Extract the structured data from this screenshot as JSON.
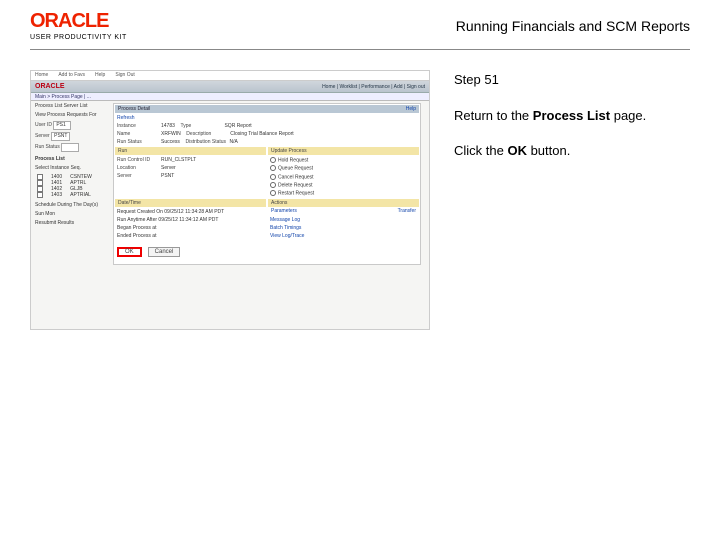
{
  "header": {
    "logo": "ORACLE",
    "productLine": "USER PRODUCTIVITY KIT",
    "title": "Running Financials and SCM Reports"
  },
  "instructions": {
    "step": "Step 51",
    "line1a": "Return to the ",
    "line1bold": "Process List",
    "line1b": " page.",
    "line2a": "Click the ",
    "line2bold": "OK",
    "line2b": " button."
  },
  "screenshot": {
    "topbar": [
      "Home",
      "Add to Favs",
      "Help",
      "Sign Out"
    ],
    "oracleLogo": "ORACLE",
    "navRight": "Home | Worklist | Performance | Add | Sign out",
    "tabs": "Main > Process Page | ...",
    "left": {
      "tabs": "Process List   Server List",
      "viewLabel": "View Process Requests For",
      "userId": "User ID",
      "userIdVal": "PS1",
      "server": "Server",
      "serverVal": "PSNT",
      "runStatus": "Run Status",
      "processListLabel": "Process List",
      "cols": "Select   Instance   Seq.",
      "r1": "1400",
      "r1b": "CSNTEW",
      "r2": "1401",
      "r2b": "APTRL",
      "r3": "1402",
      "r3b": "GLJB",
      "r4": "1403",
      "r4b": "APTRIAL",
      "schedule": "Schedule During The Day(s)",
      "sun": "Sun",
      "mon": "Mon",
      "resubmit": "Resubmit Results"
    },
    "panel": {
      "title": "Process Detail",
      "help": "Help",
      "refresh": "Refresh",
      "process": "Process",
      "instance": "Instance",
      "instanceVal": "14783",
      "type": "Type",
      "typeVal": "SQR Report",
      "name": "Name",
      "nameVal": "XRFWIN",
      "desc": "Description",
      "descVal": "Closing Trial Balance Report",
      "runStatus": "Run Status",
      "runStatusVal": "Success",
      "distStatus": "Distribution Status",
      "distStatusVal": "N/A",
      "runHead": "Run",
      "updateHead": "Update Process",
      "runCtlId": "Run Control ID",
      "runCtlIdVal": "RUN_CLSTPLT",
      "location": "Location",
      "locationVal": "Server",
      "serverLabel": "Server",
      "serverVal": "PSNT",
      "holdReq": "Hold Request",
      "queueReq": "Queue Request",
      "cancelReq": "Cancel Request",
      "deleteReq": "Delete Request",
      "restartReq": "Restart Request",
      "dateHead": "Date/Time",
      "actionsHead": "Actions",
      "reqCreated": "Request Created On",
      "reqCreatedVal": "09/25/12 11:34:28 AM PDT",
      "runAnytime": "Run Anytime After",
      "runAnytimeVal": "09/25/12 11:34:12 AM PDT",
      "began": "Began Process at",
      "ended": "Ended Process at",
      "paramsLink": "Parameters",
      "transferLink": "Transfer",
      "msgLogLink": "Message Log",
      "batchLink": "Batch Timings",
      "viewLogLink": "View Log/Trace",
      "ok": "OK",
      "cancel": "Cancel"
    }
  }
}
